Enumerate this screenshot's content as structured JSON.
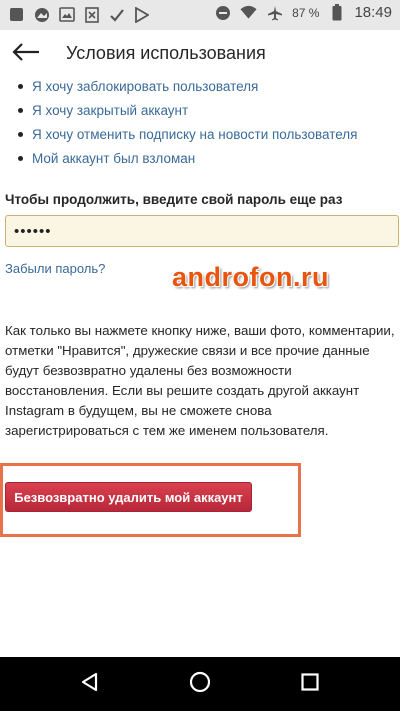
{
  "status_bar": {
    "battery_percent": "87 %",
    "time": "18:49",
    "left_icons": [
      "notification-square-icon",
      "photos-icon",
      "gallery-icon",
      "blocked-file-icon",
      "check-icon",
      "play-store-icon"
    ],
    "right_icons": [
      "do-not-disturb-icon",
      "wifi-icon",
      "airplane-icon",
      "battery-icon"
    ]
  },
  "app_bar": {
    "title": "Условия использования",
    "back_icon": "arrow-left-icon"
  },
  "links": [
    "Я хочу заблокировать пользователя",
    "Я хочу закрытый аккаунт",
    "Я хочу отменить подписку на новости пользователя",
    "Мой аккаунт был взломан"
  ],
  "password": {
    "label": "Чтобы продолжить, введите свой пароль еще раз",
    "value": "••••••"
  },
  "forgot_password": "Забыли пароль?",
  "watermark": "androfon.ru",
  "description": "Как только вы нажмете кнопку ниже, ваши фото, комментарии, отметки \"Нравится\", дружеские связи и все прочие данные будут безвозвратно удалены без возможности восстановления. Если вы решите создать другой аккаунт Instagram в будущем, вы не сможете снова зарегистрироваться с тем же именем пользователя.",
  "delete_button": "Безвозвратно удалить мой аккаунт",
  "colors": {
    "link": "#3a6a9a",
    "delete_button": "#c8303f",
    "highlight_border": "#e8734a",
    "watermark": "#e9540e",
    "input_bg": "#fbf6e4"
  },
  "nav_bar": {
    "buttons": [
      "back-triangle-icon",
      "home-circle-icon",
      "recents-square-icon"
    ]
  }
}
